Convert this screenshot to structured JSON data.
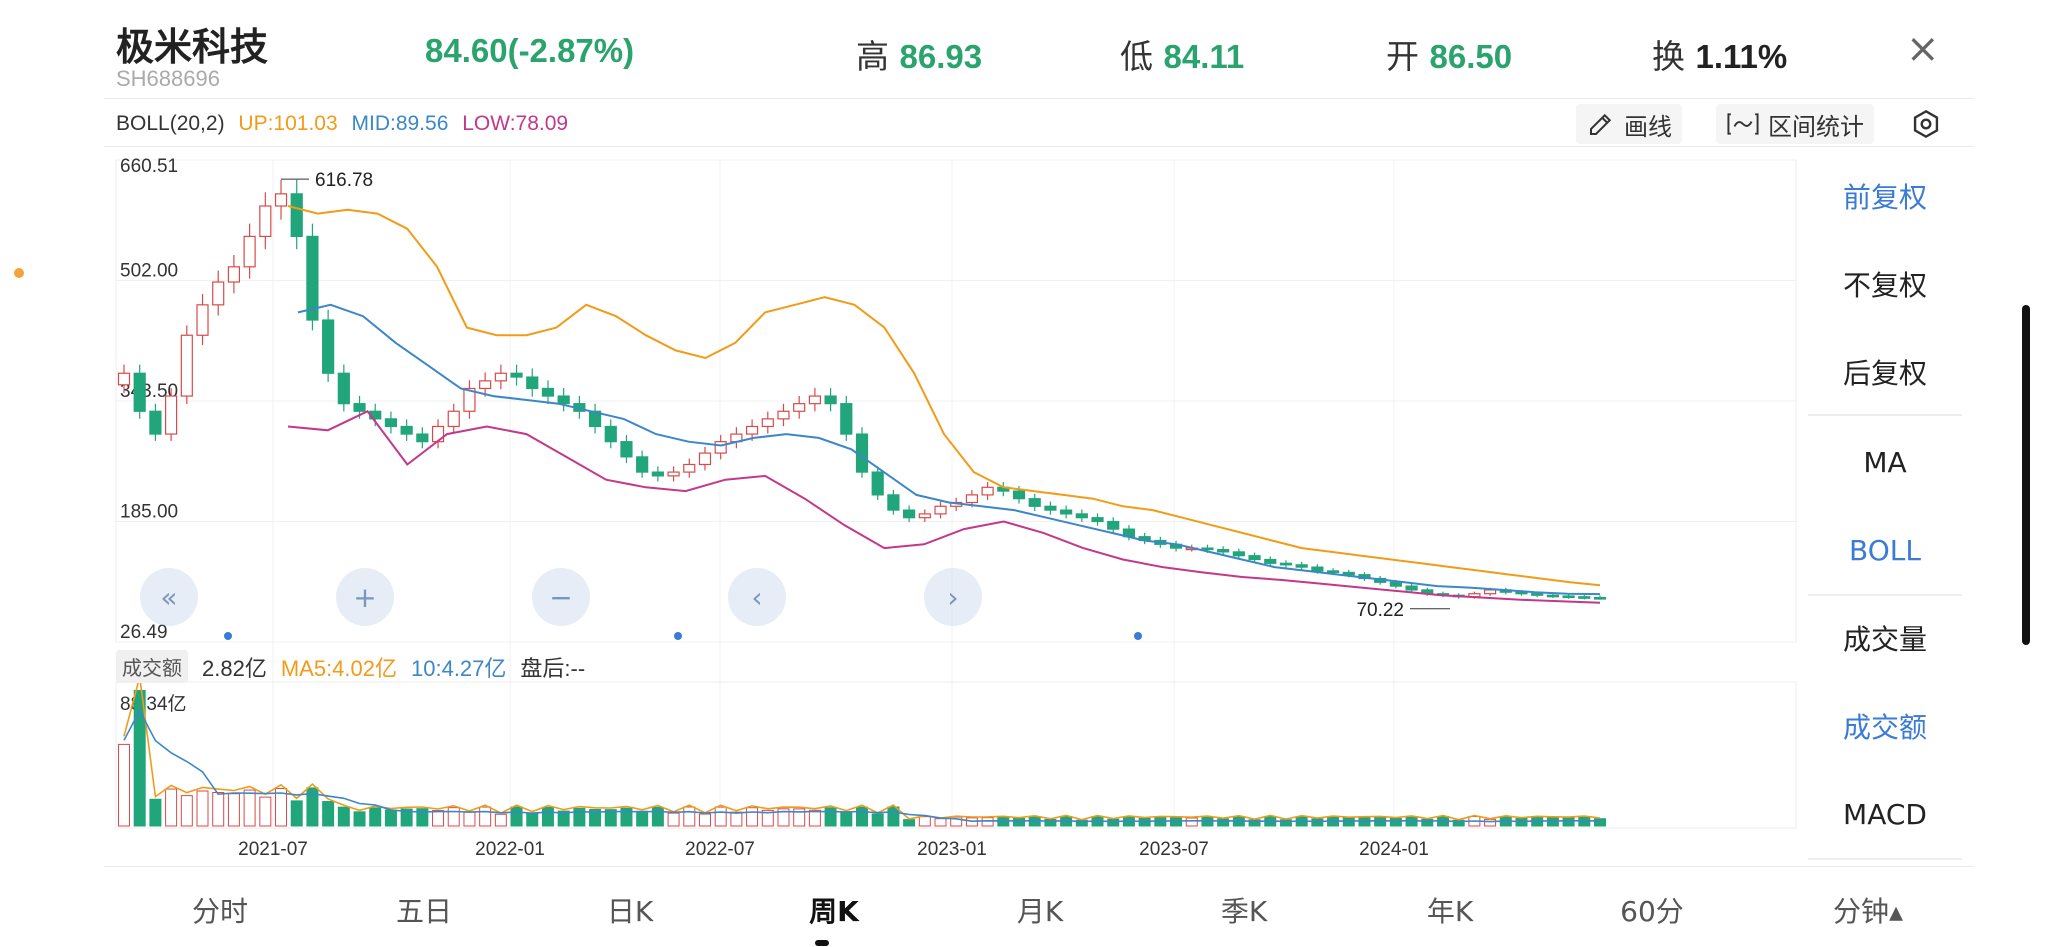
{
  "header": {
    "name": "极米科技",
    "code": "SH688696",
    "price": "84.60(-2.87%)",
    "high_label": "高",
    "high": "86.93",
    "low_label": "低",
    "low": "84.11",
    "open_label": "开",
    "open": "86.50",
    "turnover_label": "换",
    "turnover": "1.11%",
    "close_icon": "close-icon",
    "close_glyph": "×"
  },
  "indicator": {
    "name": "BOLL(20,2)",
    "up": "UP:101.03",
    "mid": "MID:89.56",
    "low": "LOW:78.09",
    "colors": {
      "up": "#f29b18",
      "mid": "#3b87c8",
      "low": "#c2388a"
    }
  },
  "toolbar": {
    "draw_label": "画线",
    "stats_label": "区间统计",
    "draw_icon": "pencil-icon",
    "stats_icon": "range-icon",
    "settings_icon": "gear-icon"
  },
  "side_menu": [
    {
      "label": "前复权",
      "active": true
    },
    {
      "label": "不复权",
      "active": false
    },
    {
      "label": "后复权",
      "active": false
    },
    {
      "label": "MA",
      "active": false
    },
    {
      "label": "BOLL",
      "active": true
    },
    {
      "label": "成交量",
      "active": false
    },
    {
      "label": "成交额",
      "active": true
    },
    {
      "label": "MACD",
      "active": false
    }
  ],
  "volume": {
    "tag": "成交额",
    "value": "2.82亿",
    "ma5": "MA5:4.02亿",
    "ma10": "10:4.27亿",
    "after": "盘后:--",
    "max_label": "88.34亿"
  },
  "tabs": [
    {
      "label": "分时",
      "active": false
    },
    {
      "label": "五日",
      "active": false
    },
    {
      "label": "日K",
      "active": false
    },
    {
      "label": "周K",
      "active": true
    },
    {
      "label": "月K",
      "active": false
    },
    {
      "label": "季K",
      "active": false
    },
    {
      "label": "年K",
      "active": false
    },
    {
      "label": "60分",
      "active": false
    },
    {
      "label": "分钟▴",
      "active": false
    }
  ],
  "nav_buttons": {
    "first": "«",
    "zoom_in": "+",
    "zoom_out": "−",
    "prev": "‹",
    "next": "›"
  },
  "chart_data": {
    "type": "candlestick",
    "y_ticks": [
      "660.51",
      "502.00",
      "343.50",
      "185.00",
      "26.49"
    ],
    "ylim": [
      26.49,
      660.51
    ],
    "x_tick_labels": [
      "2021-07",
      "2022-01",
      "2022-07",
      "2023-01",
      "2023-07",
      "2024-01"
    ],
    "max_annotation": "616.78",
    "min_annotation": "70.22",
    "candle_colors": {
      "up": "#d84a4a",
      "down": "#21a57a"
    },
    "candles_weekly_close_approx": [
      380,
      330,
      300,
      350,
      430,
      470,
      500,
      520,
      560,
      600,
      616,
      560,
      450,
      380,
      340,
      330,
      320,
      310,
      300,
      290,
      310,
      330,
      360,
      370,
      380,
      375,
      360,
      350,
      340,
      330,
      310,
      290,
      270,
      250,
      245,
      250,
      260,
      275,
      290,
      300,
      310,
      320,
      330,
      340,
      350,
      340,
      300,
      250,
      220,
      200,
      190,
      195,
      205,
      210,
      220,
      230,
      225,
      215,
      205,
      200,
      195,
      190,
      185,
      175,
      165,
      160,
      155,
      150,
      150,
      148,
      145,
      140,
      135,
      130,
      128,
      125,
      120,
      118,
      115,
      110,
      105,
      100,
      95,
      90,
      88,
      86,
      90,
      95,
      92,
      90,
      88,
      87,
      86,
      85,
      84.6
    ],
    "boll_up_approx": [
      600,
      590,
      595,
      590,
      570,
      520,
      440,
      430,
      430,
      440,
      470,
      455,
      430,
      410,
      400,
      420,
      460,
      470,
      480,
      470,
      440,
      380,
      300,
      250,
      230,
      225,
      220,
      215,
      205,
      200,
      190,
      180,
      170,
      160,
      150,
      145,
      140,
      135,
      130,
      125,
      120,
      115,
      110,
      105,
      101.03
    ],
    "boll_mid_approx": [
      460,
      470,
      455,
      420,
      390,
      360,
      350,
      345,
      340,
      330,
      320,
      300,
      290,
      285,
      295,
      300,
      295,
      280,
      250,
      220,
      210,
      205,
      200,
      190,
      180,
      170,
      160,
      155,
      145,
      135,
      125,
      120,
      115,
      110,
      105,
      100,
      98,
      95,
      92,
      90,
      89.56
    ],
    "boll_low_approx": [
      310,
      305,
      330,
      260,
      300,
      310,
      300,
      270,
      240,
      230,
      225,
      240,
      245,
      215,
      180,
      150,
      155,
      175,
      185,
      170,
      150,
      135,
      125,
      118,
      112,
      108,
      103,
      98,
      93,
      88,
      85,
      82,
      80,
      78.09
    ],
    "volume_max": "88.34亿"
  }
}
